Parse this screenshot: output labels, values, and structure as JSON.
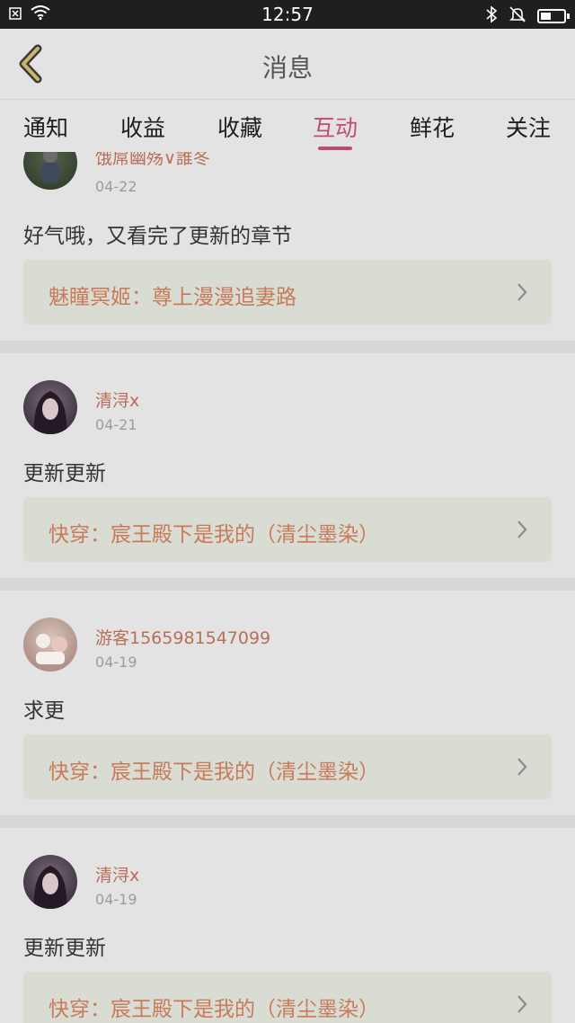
{
  "status_bar": {
    "time": "12:57",
    "battery_level": 0.45
  },
  "nav": {
    "title": "消息"
  },
  "tabs": [
    {
      "label": "通知"
    },
    {
      "label": "收益"
    },
    {
      "label": "收藏"
    },
    {
      "label": "互动",
      "active": true
    },
    {
      "label": "鲜花"
    },
    {
      "label": "关注"
    }
  ],
  "feed": [
    {
      "username": "饿屌幽殇∨誰冬",
      "date": "04-22",
      "comment": "好气哦，又看完了更新的章节",
      "book": "魅瞳冥姬：尊上漫漫追妻路"
    },
    {
      "username": "清浔x",
      "date": "04-21",
      "comment": "更新更新",
      "book": "快穿：宸王殿下是我的（清尘墨染）"
    },
    {
      "username": "游客1565981547099",
      "date": "04-19",
      "comment": "求更",
      "book": "快穿：宸王殿下是我的（清尘墨染）"
    },
    {
      "username": "清浔x",
      "date": "04-19",
      "comment": "更新更新",
      "book": "快穿：宸王殿下是我的（清尘墨染）"
    }
  ],
  "colors": {
    "accent": "#c04a73",
    "username": "#b86f5a",
    "book_title": "#c87a5a"
  }
}
